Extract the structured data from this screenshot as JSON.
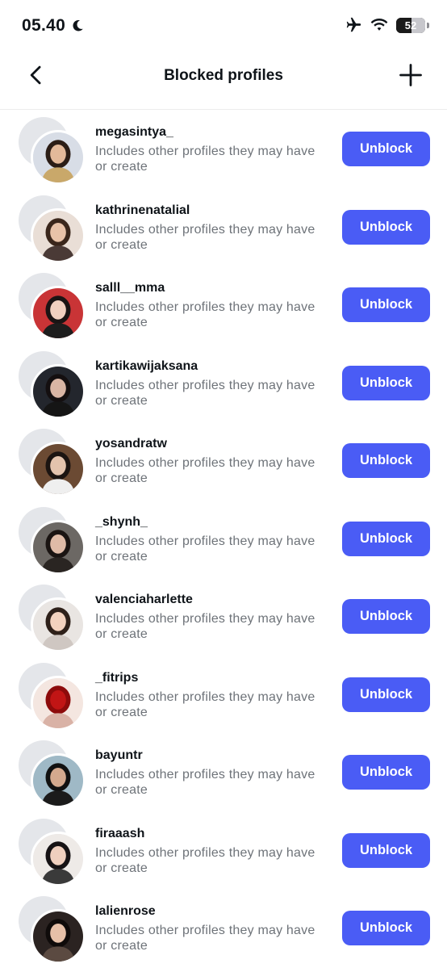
{
  "status_bar": {
    "time": "05.40",
    "battery": "52",
    "battery_level": 0.52,
    "icons": [
      "moon-icon",
      "airplane-icon",
      "wifi-icon",
      "battery-icon"
    ]
  },
  "header": {
    "title": "Blocked profiles",
    "back_icon": "chevron-left-icon",
    "add_icon": "plus-icon"
  },
  "colors": {
    "accent": "#4a5cf5",
    "avatar_placeholder": "#e4e6ea"
  },
  "profiles": [
    {
      "username": "megasintya_",
      "line1": "Includes other profiles they may have",
      "line2": "or create",
      "button": "Unblock"
    },
    {
      "username": "kathrinenatalial",
      "line1": "Includes other profiles they may have",
      "line2": "or create",
      "button": "Unblock"
    },
    {
      "username": "salll__mma",
      "line1": "Includes other profiles they may have",
      "line2": "or create",
      "button": "Unblock"
    },
    {
      "username": "kartikawijaksana",
      "line1": "Includes other profiles they may have",
      "line2": "or create",
      "button": "Unblock"
    },
    {
      "username": "yosandratw",
      "line1": "Includes other profiles they may have",
      "line2": "or create",
      "button": "Unblock"
    },
    {
      "username": "_shynh_",
      "line1": "Includes other profiles they may have",
      "line2": "or create",
      "button": "Unblock"
    },
    {
      "username": "valenciaharlette",
      "line1": "Includes other profiles they may have",
      "line2": "or create",
      "button": "Unblock"
    },
    {
      "username": "_fitrips",
      "line1": "Includes other profiles they may have",
      "line2": "or create",
      "button": "Unblock"
    },
    {
      "username": "bayuntr",
      "line1": "Includes other profiles they may have",
      "line2": "or create",
      "button": "Unblock"
    },
    {
      "username": "firaaash",
      "line1": "Includes other profiles they may have",
      "line2": "or create",
      "button": "Unblock"
    },
    {
      "username": "lalienrose",
      "line1": "Includes other profiles they may have",
      "line2": "or create",
      "button": "Unblock"
    }
  ]
}
